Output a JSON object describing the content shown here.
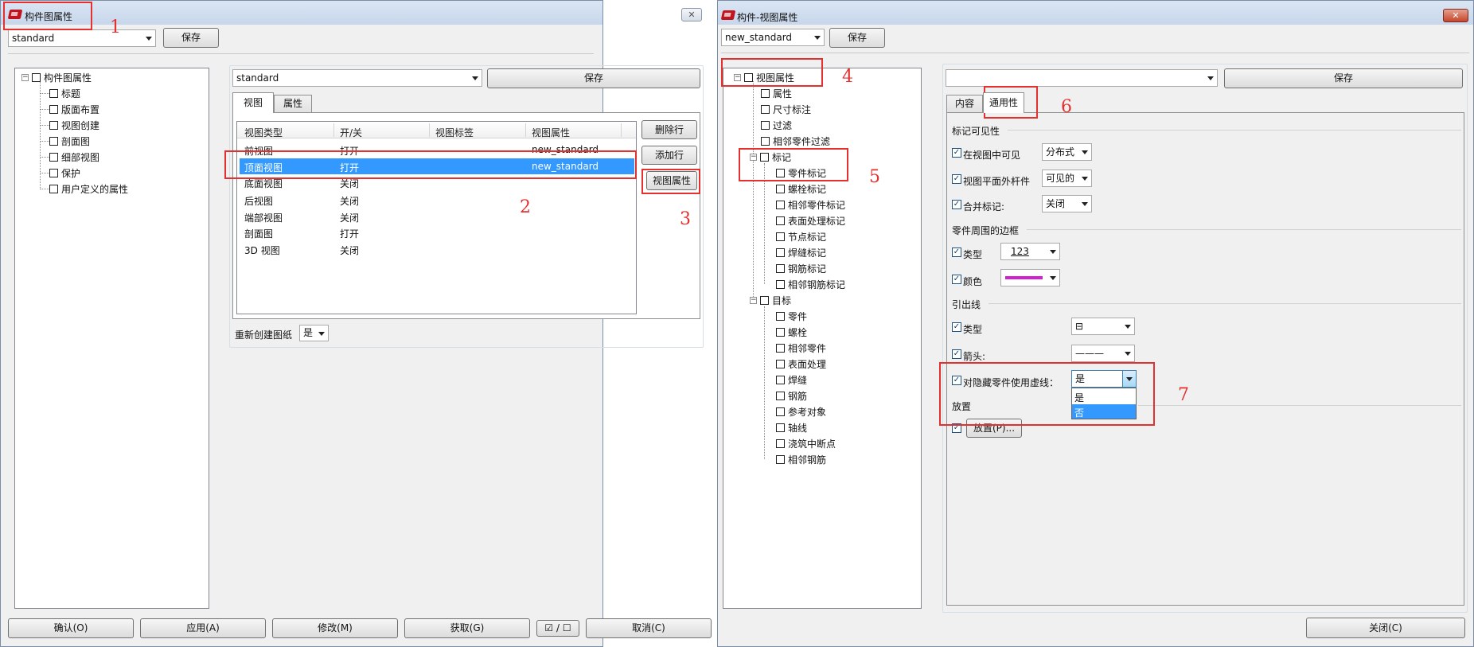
{
  "left_window": {
    "title": "构件图属性",
    "top_combo": "standard",
    "top_save": "保存",
    "tree": {
      "root": "构件图属性",
      "items": [
        "标题",
        "版面布置",
        "视图创建",
        "剖面图",
        "细部视图",
        "保护",
        "用户定义的属性"
      ]
    },
    "inner_combo": "standard",
    "inner_save": "保存",
    "tabs": [
      "视图",
      "属性"
    ],
    "table": {
      "headers": [
        "视图类型",
        "开/关",
        "视图标签",
        "视图属性"
      ],
      "rows": [
        {
          "type": "前视图",
          "onoff": "打开",
          "label": "",
          "attr": "new_standard"
        },
        {
          "type": "顶面视图",
          "onoff": "打开",
          "label": "",
          "attr": "new_standard"
        },
        {
          "type": "底面视图",
          "onoff": "关闭",
          "label": "",
          "attr": ""
        },
        {
          "type": "后视图",
          "onoff": "关闭",
          "label": "",
          "attr": ""
        },
        {
          "type": "端部视图",
          "onoff": "关闭",
          "label": "",
          "attr": ""
        },
        {
          "type": "剖面图",
          "onoff": "打开",
          "label": "",
          "attr": ""
        },
        {
          "type": "3D 视图",
          "onoff": "关闭",
          "label": "",
          "attr": ""
        }
      ],
      "selected_index": 1
    },
    "side_buttons": [
      "删除行",
      "添加行",
      "视图属性"
    ],
    "recreate_label": "重新创建图纸",
    "recreate_value": "是",
    "bottom_buttons": [
      "确认(O)",
      "应用(A)",
      "修改(M)",
      "获取(G)",
      "☑ / ☐",
      "取消(C)"
    ]
  },
  "right_window": {
    "title": "构件-视图属性",
    "top_combo": "new_standard",
    "top_save": "保存",
    "tree": {
      "root": "视图属性",
      "items": [
        "属性",
        "尺寸标注",
        "过滤",
        "相邻零件过滤"
      ],
      "marks_group": "标记",
      "marks_items": [
        "零件标记",
        "螺栓标记",
        "相邻零件标记",
        "表面处理标记",
        "节点标记",
        "焊缝标记",
        "钢筋标记",
        "相邻钢筋标记"
      ],
      "objects_group": "目标",
      "objects_items": [
        "零件",
        "螺栓",
        "相邻零件",
        "表面处理",
        "焊缝",
        "钢筋",
        "参考对象",
        "轴线",
        "浇筑中断点",
        "相邻钢筋"
      ]
    },
    "inner_combo": "",
    "inner_save": "保存",
    "tabs": [
      "内容",
      "通用性"
    ],
    "sections": {
      "mark_visibility": "标记可见性",
      "border": "零件周围的边框",
      "leader": "引出线",
      "placement": "放置"
    },
    "rows": {
      "visible_in_view": {
        "label": "在视图中可见",
        "value": "分布式"
      },
      "outside_plane": {
        "label": "视图平面外杆件",
        "value": "可见的"
      },
      "merge_marks": {
        "label": "合并标记:",
        "value": "关闭"
      },
      "border_type": {
        "label": "类型",
        "value": "123"
      },
      "border_color": {
        "label": "颜色",
        "color": "#d020d0"
      },
      "leader_type": {
        "label": "类型",
        "value": "⊟"
      },
      "arrow": {
        "label": "箭头:",
        "value": "———"
      },
      "hidden_dashed": {
        "label": "对隐藏零件使用虚线：",
        "value": "是",
        "options": [
          "是",
          "否"
        ],
        "highlighted": "否"
      },
      "placement_button": "放置(P)..."
    },
    "close_button": "关闭(C)"
  },
  "annotations": [
    "1",
    "2",
    "3",
    "4",
    "5",
    "6",
    "7"
  ]
}
